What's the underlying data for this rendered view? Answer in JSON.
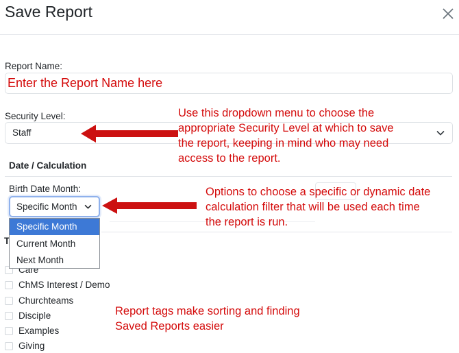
{
  "dialog": {
    "title": "Save Report"
  },
  "report_name": {
    "label": "Report Name:",
    "placeholder": "Enter the Report Name here"
  },
  "security_level": {
    "label": "Security Level:",
    "value": "Staff"
  },
  "date_calc": {
    "section_title": "Date / Calculation",
    "field_label": "Birth Date Month:",
    "selected": "Specific Month",
    "options": [
      "Specific Month",
      "Current Month",
      "Next Month"
    ]
  },
  "tags": {
    "heading": "T",
    "items": [
      "Care",
      "ChMS Interest / Demo",
      "Churchteams",
      "Disciple",
      "Examples",
      "Giving"
    ]
  },
  "annotations": {
    "security": "Use this dropdown menu to choose the appropriate Security Level at which to save the report, keeping in mind who may need access to the report.",
    "security_lines": [
      "Use this dropdown menu to choose the",
      "appropriate Security Level at which to save",
      "the report, keeping in mind who may need",
      "access to the report."
    ],
    "date_lines": [
      "Options to choose a specific or dynamic date",
      "calculation filter that will be used each time",
      "the report is run."
    ],
    "tags_lines": [
      "Report tags make sorting and finding",
      "Saved Reports easier"
    ]
  },
  "colors": {
    "annotation_red": "#d40b0b",
    "selected_option_bg": "#3d79d6",
    "focus_border": "#8fb1ec"
  }
}
